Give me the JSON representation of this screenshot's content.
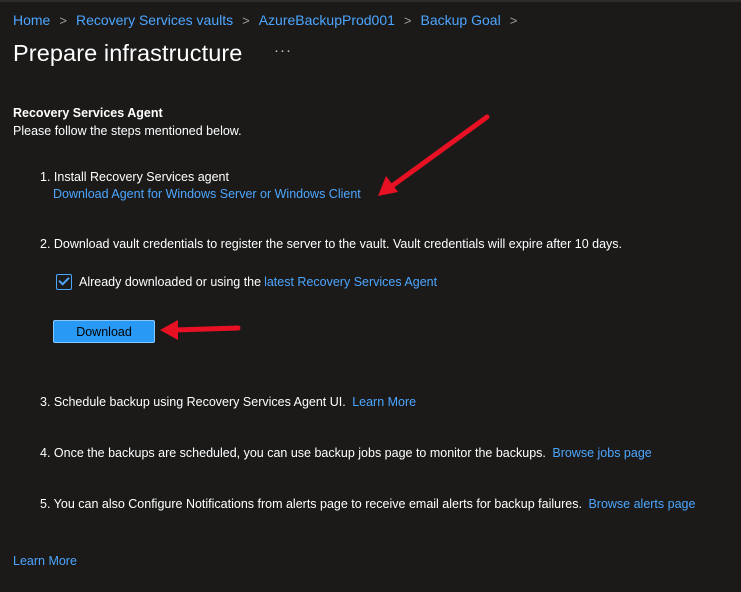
{
  "breadcrumb": {
    "items": [
      "Home",
      "Recovery Services vaults",
      "AzureBackupProd001",
      "Backup Goal"
    ],
    "separator": ">"
  },
  "page": {
    "title": "Prepare infrastructure",
    "more": "···"
  },
  "section": {
    "title": "Recovery Services Agent",
    "subtitle": "Please follow the steps mentioned below."
  },
  "steps": {
    "s1": {
      "text": "1. Install Recovery Services agent",
      "link": "Download Agent for Windows Server or Windows Client"
    },
    "s2": {
      "text": "2. Download vault credentials to register the server to the vault. Vault credentials will expire after 10 days."
    },
    "checkbox": {
      "label": "Already downloaded or using the ",
      "link": "latest Recovery Services Agent",
      "checked": true
    },
    "download_button": "Download",
    "s3": {
      "text": "3. Schedule backup using Recovery Services Agent UI. ",
      "link": "Learn More"
    },
    "s4": {
      "text": "4. Once the backups are scheduled, you can use backup jobs page to monitor the backups. ",
      "link": "Browse jobs page"
    },
    "s5": {
      "text": "5. You can also Configure Notifications from alerts page to receive email alerts for backup failures. ",
      "link": "Browse alerts page"
    }
  },
  "footer": {
    "learn_more": "Learn More"
  },
  "colors": {
    "background": "#1b1a19",
    "link": "#4ca6ff",
    "button": "#2899f5",
    "annotation_arrow": "#e81123"
  }
}
